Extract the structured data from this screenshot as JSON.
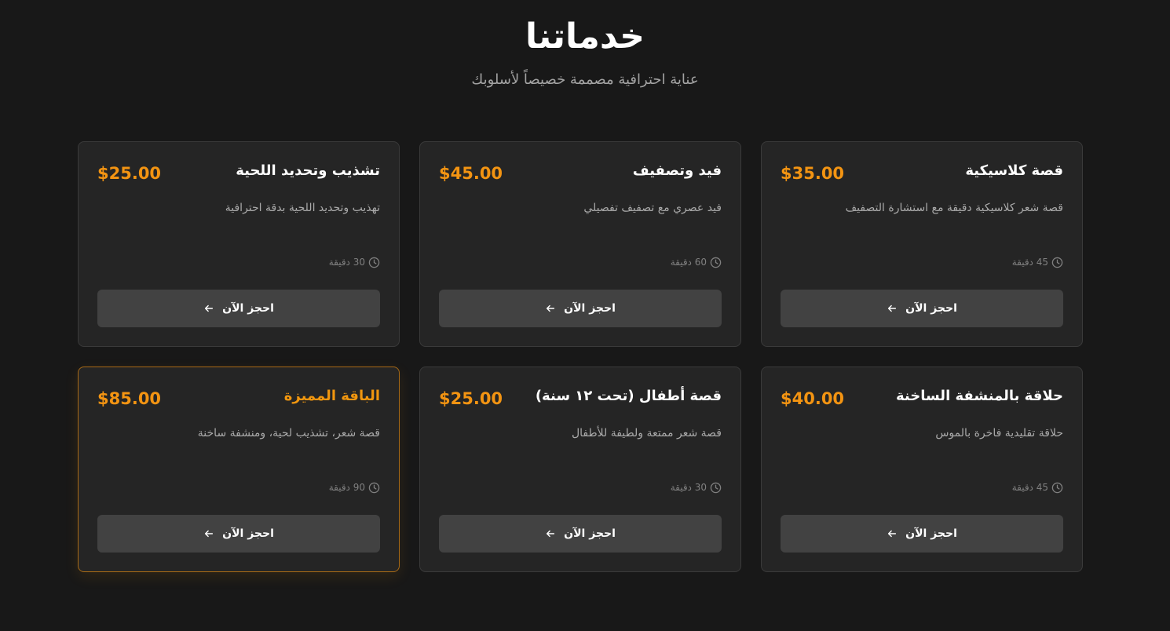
{
  "header": {
    "title": "خدماتنا",
    "subtitle": "عناية احترافية مصممة خصيصاً لأسلوبك"
  },
  "colors": {
    "background": "#181818",
    "card_background": "#252525",
    "accent": "#f39412",
    "button_background": "#424242"
  },
  "icons": {
    "duration": "clock-icon",
    "button": "arrow-left-icon"
  },
  "services": [
    {
      "title": "قصة كلاسيكية",
      "price": "$35.00",
      "description": "قصة شعر كلاسيكية دقيقة مع استشارة التصفيف",
      "duration": "45 دقيقة",
      "button_label": "احجز الآن",
      "featured": false
    },
    {
      "title": "فيد وتصفيف",
      "price": "$45.00",
      "description": "فيد عصري مع تصفيف تفصيلي",
      "duration": "60 دقيقة",
      "button_label": "احجز الآن",
      "featured": false
    },
    {
      "title": "تشذيب وتحديد اللحية",
      "price": "$25.00",
      "description": "تهذيب وتحديد اللحية بدقة احترافية",
      "duration": "30 دقيقة",
      "button_label": "احجز الآن",
      "featured": false
    },
    {
      "title": "حلاقة بالمنشفة الساخنة",
      "price": "$40.00",
      "description": "حلاقة تقليدية فاخرة بالموس",
      "duration": "45 دقيقة",
      "button_label": "احجز الآن",
      "featured": false
    },
    {
      "title": "قصة أطفال (تحت ١٢ سنة)",
      "price": "$25.00",
      "description": "قصة شعر ممتعة ولطيفة للأطفال",
      "duration": "30 دقيقة",
      "button_label": "احجز الآن",
      "featured": false
    },
    {
      "title": "الباقة المميزة",
      "price": "$85.00",
      "description": "قصة شعر، تشذيب لحية، ومنشفة ساخنة",
      "duration": "90 دقيقة",
      "button_label": "احجز الآن",
      "featured": true
    }
  ]
}
